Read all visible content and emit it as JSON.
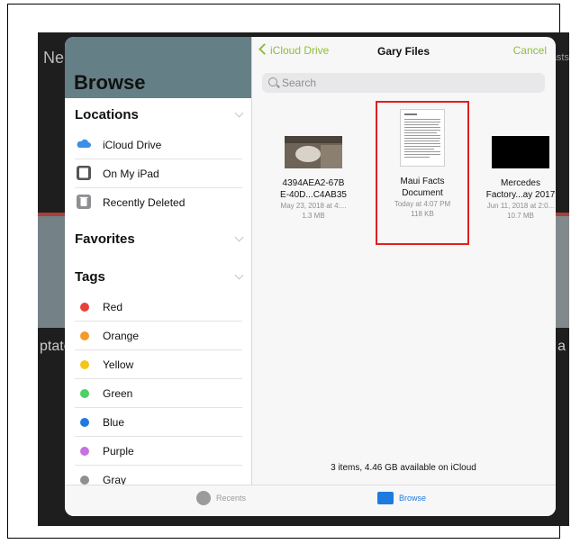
{
  "background": {
    "left_text": "Ne",
    "left_lower_text": "ptate",
    "right_text": "asts",
    "right_lower_text": "a"
  },
  "sidebar": {
    "title": "Browse",
    "locations_header": "Locations",
    "locations": [
      {
        "label": "iCloud Drive",
        "icon": "cloud-icon"
      },
      {
        "label": "On My iPad",
        "icon": "ipad-icon"
      },
      {
        "label": "Recently Deleted",
        "icon": "trash-icon"
      }
    ],
    "favorites_header": "Favorites",
    "tags_header": "Tags",
    "tags": [
      {
        "label": "Red",
        "color": "#e8413a"
      },
      {
        "label": "Orange",
        "color": "#f39a27"
      },
      {
        "label": "Yellow",
        "color": "#f5c518"
      },
      {
        "label": "Green",
        "color": "#4cd264"
      },
      {
        "label": "Blue",
        "color": "#1f7ae0"
      },
      {
        "label": "Purple",
        "color": "#c572e0"
      },
      {
        "label": "Gray",
        "color": "#8e8e93"
      }
    ]
  },
  "nav": {
    "back_label": "iCloud Drive",
    "title": "Gary Files",
    "cancel_label": "Cancel"
  },
  "search": {
    "placeholder": "Search"
  },
  "files": [
    {
      "name_line1": "4394AEA2-67B",
      "name_line2": "E-40D...C4AB35",
      "date": "May 23, 2018 at 4:...",
      "size": "1.3 MB"
    },
    {
      "name_line1": "Maui Facts",
      "name_line2": "Document",
      "date": "Today at 4:07 PM",
      "size": "118 KB"
    },
    {
      "name_line1": "Mercedes",
      "name_line2": "Factory...ay 2017",
      "date": "Jun 11, 2018 at 2:0...",
      "size": "10.7 MB"
    }
  ],
  "footer_info": "3 items, 4.46 GB available on iCloud",
  "tabbar": {
    "recents": "Recents",
    "browse": "Browse"
  },
  "colors": {
    "accent_green": "#8fbe3c",
    "header_teal": "#657f86",
    "highlight_red": "#e0201e",
    "tab_blue": "#1f7ae0"
  }
}
